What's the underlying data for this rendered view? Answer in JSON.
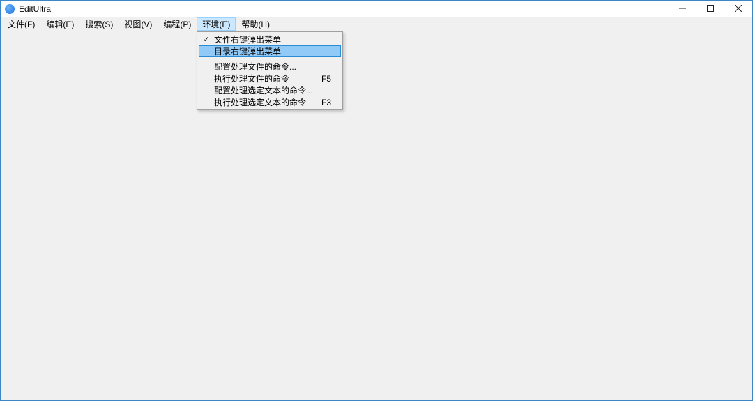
{
  "window": {
    "title": "EditUltra"
  },
  "menubar": {
    "items": [
      {
        "label": "文件(F)"
      },
      {
        "label": "编辑(E)"
      },
      {
        "label": "搜索(S)"
      },
      {
        "label": "视图(V)"
      },
      {
        "label": "编程(P)"
      },
      {
        "label": "环境(E)"
      },
      {
        "label": "帮助(H)"
      }
    ],
    "active_index": 5
  },
  "dropdown": {
    "items": [
      {
        "label": "文件右键弹出菜单",
        "checked": true,
        "shortcut": ""
      },
      {
        "label": "目录右键弹出菜单",
        "checked": false,
        "shortcut": "",
        "highlight": true
      },
      {
        "separator": true
      },
      {
        "label": "配置处理文件的命令...",
        "checked": false,
        "shortcut": ""
      },
      {
        "label": "执行处理文件的命令",
        "checked": false,
        "shortcut": "F5"
      },
      {
        "label": "配置处理选定文本的命令...",
        "checked": false,
        "shortcut": ""
      },
      {
        "label": "执行处理选定文本的命令",
        "checked": false,
        "shortcut": "F3"
      }
    ]
  }
}
